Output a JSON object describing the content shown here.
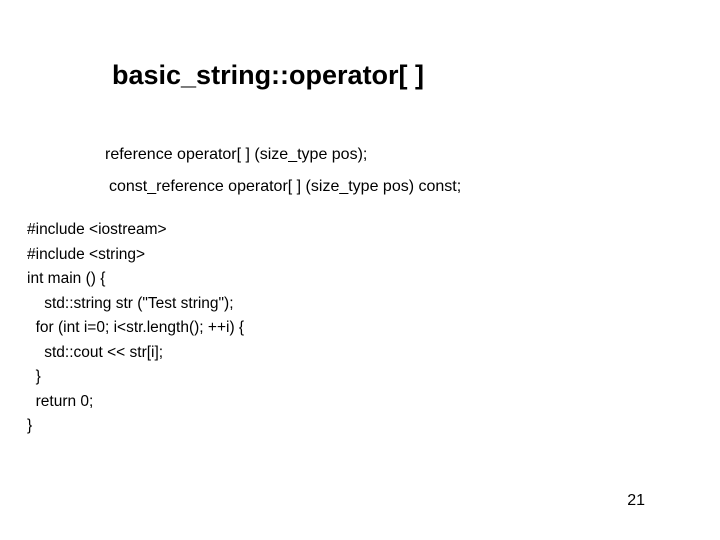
{
  "title": "basic_string::operator[ ]",
  "signatures": {
    "sig1": "reference operator[ ] (size_type pos);",
    "sig2": "const_reference operator[ ] (size_type pos) const;"
  },
  "code": {
    "l1": "#include <iostream>",
    "l2": "#include <string>",
    "l3": "int main () {",
    "l4": "    std::string str (\"Test string\");",
    "l5": "  for (int i=0; i<str.length(); ++i) {",
    "l6": "    std::cout << str[i];",
    "l7": "  }",
    "l8": "  return 0;",
    "l9": "}"
  },
  "pageNumber": "21"
}
